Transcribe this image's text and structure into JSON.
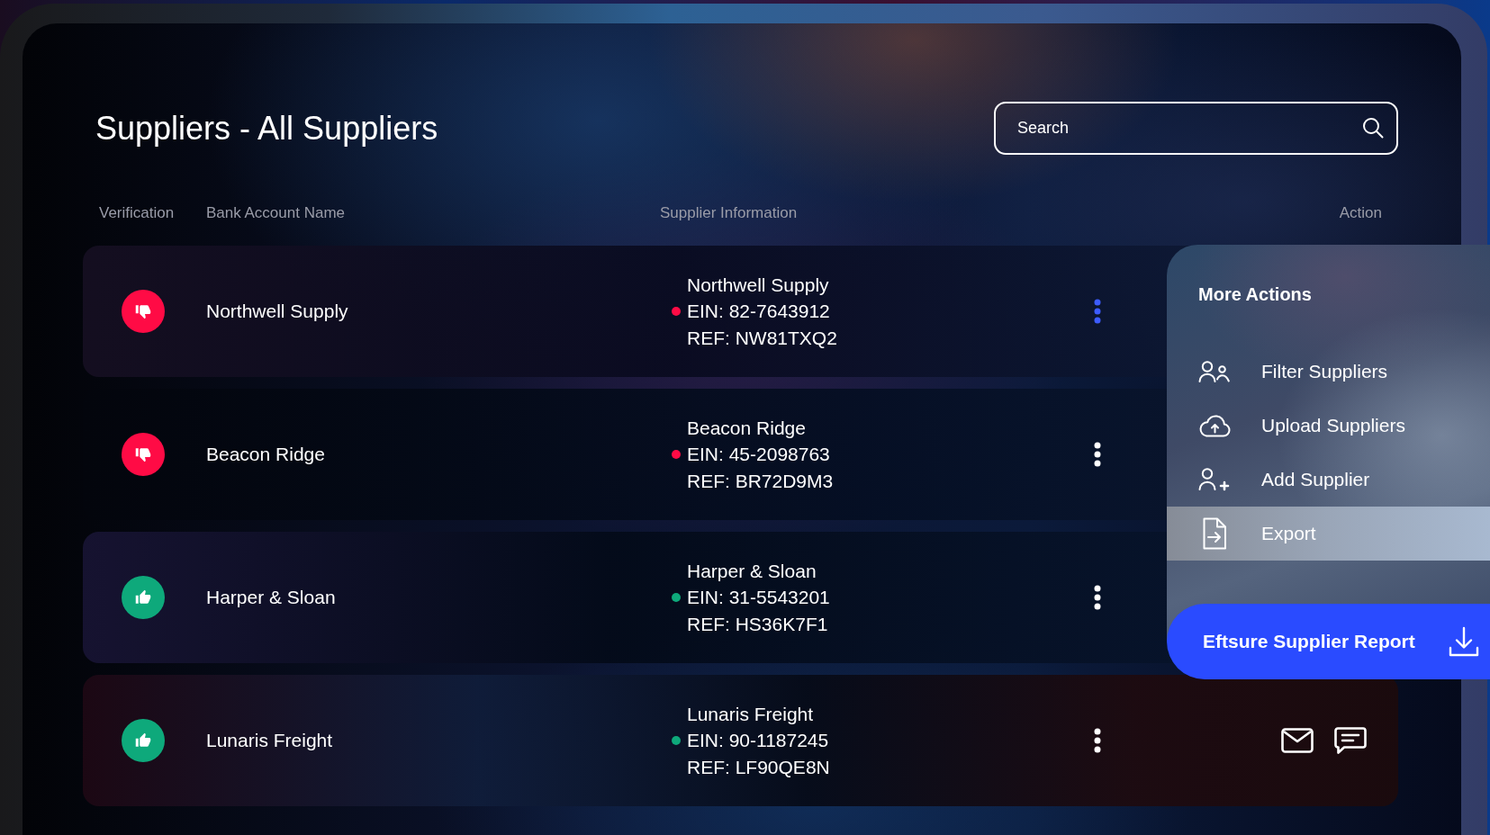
{
  "page": {
    "title": "Suppliers - All Suppliers"
  },
  "search": {
    "placeholder": "Search"
  },
  "table": {
    "columns": [
      "Verification",
      "Bank Account Name",
      "Supplier Information",
      "Action"
    ],
    "rows": [
      {
        "verified": false,
        "bank_account_name": "Northwell Supply",
        "supplier_name": "Northwell Supply",
        "ein": "EIN: 82-7643912",
        "ref": "REF: NW81TXQ2",
        "menu_open": true,
        "contact_icons": false
      },
      {
        "verified": false,
        "bank_account_name": "Beacon Ridge",
        "supplier_name": "Beacon Ridge",
        "ein": "EIN: 45-2098763",
        "ref": "REF: BR72D9M3",
        "menu_open": false,
        "contact_icons": false
      },
      {
        "verified": true,
        "bank_account_name": "Harper & Sloan",
        "supplier_name": "Harper & Sloan",
        "ein": "EIN: 31-5543201",
        "ref": "REF: HS36K7F1",
        "menu_open": false,
        "contact_icons": false
      },
      {
        "verified": true,
        "bank_account_name": "Lunaris Freight",
        "supplier_name": "Lunaris Freight",
        "ein": "EIN: 90-1187245",
        "ref": "REF: LF90QE8N",
        "menu_open": false,
        "contact_icons": true
      }
    ]
  },
  "more_actions": {
    "title": "More Actions",
    "items": [
      {
        "label": "Filter Suppliers",
        "selected": false
      },
      {
        "label": "Upload Suppliers",
        "selected": false
      },
      {
        "label": "Add Supplier",
        "selected": false
      },
      {
        "label": "Export",
        "selected": true
      }
    ],
    "report_button": "Eftsure Supplier Report"
  }
}
